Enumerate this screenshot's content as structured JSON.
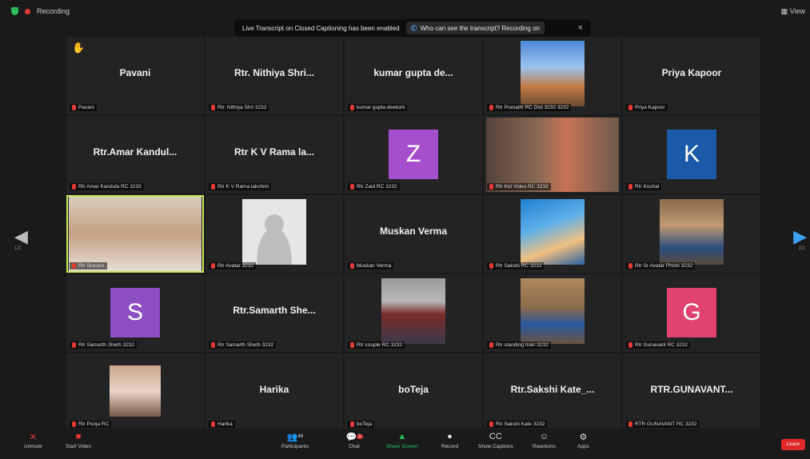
{
  "topbar": {
    "recording_label": "Recording",
    "view_label": "View"
  },
  "notice": {
    "message": "Live Transcript on Closed Captioning has been enabled",
    "captions_label": "Who can see the transcript? Recording on",
    "close": "×"
  },
  "tiles": [
    {
      "display": "Pavani",
      "label": "Pavani",
      "kind": "name",
      "hand": true
    },
    {
      "display": "Rtr. Nithiya Shri...",
      "label": "Rtr. Nithiya Shri 3232",
      "kind": "name"
    },
    {
      "display": "kumar gupta de...",
      "label": "kumar gupta deekshi",
      "kind": "name"
    },
    {
      "display": "",
      "label": "Rtr Pranathi RC Dist 3232 3232",
      "kind": "photo",
      "photo": "scenic-sky"
    },
    {
      "display": "Priya Kapoor",
      "label": "Priya Kapoor",
      "kind": "name"
    },
    {
      "display": "Rtr.Amar Kandul...",
      "label": "Rtr Amar Kandula RC 3232",
      "kind": "name"
    },
    {
      "display": "Rtr K V Rama la...",
      "label": "Rtr K V Rama lakshmi",
      "kind": "name"
    },
    {
      "display": "",
      "label": "Rtr Zaid RC 3232",
      "kind": "letter",
      "letter": "Z",
      "color": "#a64fcd"
    },
    {
      "display": "",
      "label": "Rtr Kid Video RC 3232",
      "kind": "photo",
      "photo": "child-video"
    },
    {
      "display": "",
      "label": "Rtr Kushal",
      "kind": "letter",
      "letter": "K",
      "color": "#1a5aa8"
    },
    {
      "display": "",
      "label": "Rtr Sravani",
      "kind": "photo",
      "photo": "woman-video"
    },
    {
      "display": "",
      "label": "Rtr Avatar 3232",
      "kind": "photo",
      "photo": "default-avatar"
    },
    {
      "display": "Muskan Verma",
      "label": "Muskan Verma",
      "kind": "name"
    },
    {
      "display": "",
      "label": "Rtr Sakshi RC 3232",
      "kind": "photo",
      "photo": "blue-abstract"
    },
    {
      "display": "",
      "label": "Rtr Sr Avatar Photo 3232",
      "kind": "photo",
      "photo": "standing-person"
    },
    {
      "display": "",
      "label": "Rtr Samarth Sheth 3232",
      "kind": "letter",
      "letter": "S",
      "color": "#8e4fc4"
    },
    {
      "display": "Rtr.Samarth She...",
      "label": "Rtr Samarth Sheth 3232",
      "kind": "name"
    },
    {
      "display": "",
      "label": "Rtr couple RC 3232",
      "kind": "photo",
      "photo": "couple"
    },
    {
      "display": "",
      "label": "Rtr standing man 3232",
      "kind": "photo",
      "photo": "man-wall"
    },
    {
      "display": "",
      "label": "Rtr Gunavant RC 3232",
      "kind": "letter",
      "letter": "G",
      "color": "#e0446e"
    },
    {
      "display": "",
      "label": "Rtr Pooja RC",
      "kind": "photo",
      "photo": "small-portrait"
    },
    {
      "display": "Harika",
      "label": "Harika",
      "kind": "name"
    },
    {
      "display": "boTeja",
      "label": "boTeja",
      "kind": "name"
    },
    {
      "display": "Rtr.Sakshi Kate_...",
      "label": "Rtr Sakshi Kate 3232",
      "kind": "name"
    },
    {
      "display": "RTR.GUNAVANT...",
      "label": "RTR GUNAVANT RC 3232",
      "kind": "name"
    }
  ],
  "pager": {
    "left_page": "1/2",
    "right_page": "2/2"
  },
  "toolbar": {
    "unmute": "Unmute",
    "start_video": "Start Video",
    "participants": "Participants",
    "participants_count": "46",
    "chat": "Chat",
    "chat_badge": "1",
    "share_screen": "Share Screen",
    "record": "Record",
    "closed_caption": "Show Captions",
    "reactions": "Reactions",
    "apps": "Apps",
    "end": "Leave"
  }
}
